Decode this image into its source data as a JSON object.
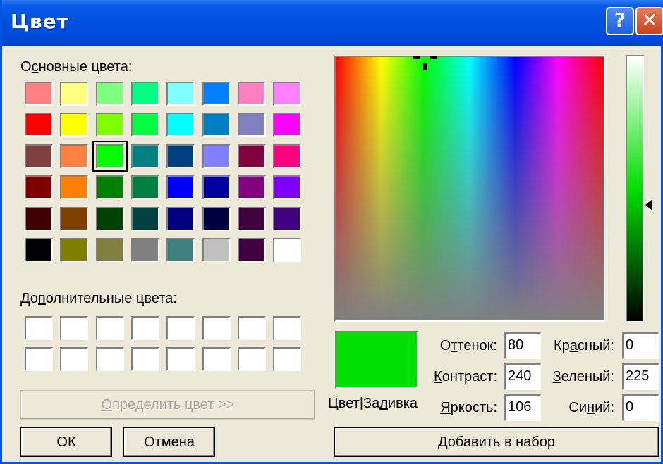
{
  "window": {
    "title": "Цвет",
    "help_label": "?",
    "close_label": "✕"
  },
  "basic_colors": {
    "label_pre": "О",
    "label_mn": "с",
    "label_post": "новные цвета:",
    "selected": "#00ff00",
    "rows": [
      [
        "#ff8080",
        "#ffff80",
        "#80ff80",
        "#00ff80",
        "#80ffff",
        "#0080ff",
        "#ff80c0",
        "#ff80ff"
      ],
      [
        "#ff0000",
        "#ffff00",
        "#80ff00",
        "#00ff40",
        "#00ffff",
        "#0080c0",
        "#8080c0",
        "#ff00ff"
      ],
      [
        "#804040",
        "#ff8040",
        "#00ff00",
        "#008080",
        "#004080",
        "#8080ff",
        "#800040",
        "#ff0080"
      ],
      [
        "#800000",
        "#ff8000",
        "#008000",
        "#008040",
        "#0000ff",
        "#0000a0",
        "#800080",
        "#8000ff"
      ],
      [
        "#400000",
        "#804000",
        "#004000",
        "#004040",
        "#000080",
        "#000040",
        "#400040",
        "#400080"
      ],
      [
        "#000000",
        "#808000",
        "#808040",
        "#808080",
        "#408080",
        "#c0c0c0",
        "#400040",
        "#ffffff"
      ]
    ]
  },
  "custom_colors": {
    "label_pre": "До",
    "label_mn": "п",
    "label_post": "олнительные цвета:",
    "rows": [
      [
        "#ffffff",
        "#ffffff",
        "#ffffff",
        "#ffffff",
        "#ffffff",
        "#ffffff",
        "#ffffff",
        "#ffffff"
      ],
      [
        "#ffffff",
        "#ffffff",
        "#ffffff",
        "#ffffff",
        "#ffffff",
        "#ffffff",
        "#ffffff",
        "#ffffff"
      ]
    ]
  },
  "define_button": {
    "mn": "О",
    "rest": "пределить цвет >>"
  },
  "ok_button": "ОК",
  "cancel_button": "Отмена",
  "preview": {
    "color": "#00e000",
    "pre": "Цвет|За",
    "mn": "л",
    "post": "ивка"
  },
  "hue": {
    "pre": "О",
    "mn": "т",
    "post": "тенок:",
    "value": "80"
  },
  "contrast": {
    "pre": "",
    "mn": "К",
    "post": "онтраст:",
    "value": "240"
  },
  "bright": {
    "pre": "",
    "mn": "Я",
    "post": "ркость:",
    "value": "106"
  },
  "red": {
    "pre": "Кр",
    "mn": "а",
    "post": "сный:",
    "value": "0"
  },
  "green": {
    "pre": "",
    "mn": "З",
    "post": "еленый:",
    "value": "225"
  },
  "blue": {
    "pre": "Си",
    "mn": "н",
    "post": "ий:",
    "value": "0"
  },
  "add_button": {
    "mn": "Д",
    "rest": "обавить в набор"
  },
  "luminance_level": 0.44,
  "spectrum_cursor_hue_fraction": 0.333
}
